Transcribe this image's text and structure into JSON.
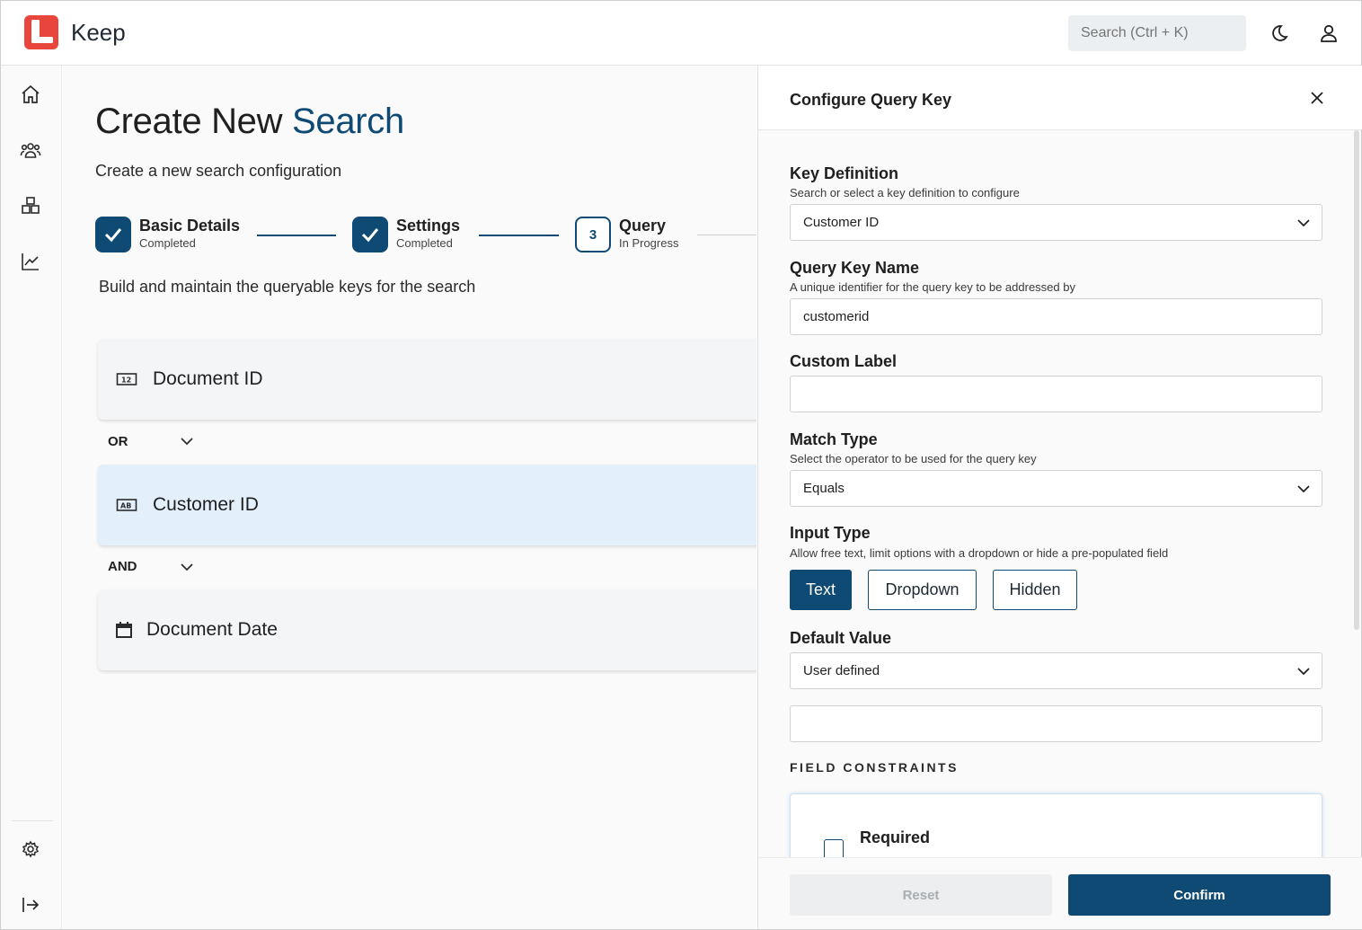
{
  "app": {
    "name": "Keep"
  },
  "header": {
    "search_placeholder": "Search (Ctrl + K)"
  },
  "sidebar": {
    "items": [
      {
        "icon": "home-icon"
      },
      {
        "icon": "users-icon"
      },
      {
        "icon": "boxes-icon"
      },
      {
        "icon": "chart-line-icon"
      }
    ],
    "bottom": [
      {
        "icon": "gear-icon"
      },
      {
        "icon": "expand-icon"
      }
    ]
  },
  "main": {
    "title_part1": "Create New ",
    "title_part2": "Search",
    "subtitle": "Create a new search configuration",
    "steps": [
      {
        "title": "Basic Details",
        "status": "Completed"
      },
      {
        "title": "Settings",
        "status": "Completed"
      },
      {
        "number": "3",
        "title": "Query",
        "status": "In Progress"
      }
    ],
    "build_text": "Build and maintain the queryable keys for the search",
    "keys": [
      {
        "label": "Document ID",
        "icon": "number-field-icon"
      },
      {
        "label": "Customer ID",
        "icon": "text-field-icon",
        "selected": true
      },
      {
        "label": "Document Date",
        "icon": "calendar-icon"
      }
    ],
    "operators": [
      "OR",
      "AND"
    ]
  },
  "panel": {
    "title": "Configure Query Key",
    "key_definition": {
      "label": "Key Definition",
      "help": "Search or select a key definition to configure",
      "value": "Customer ID"
    },
    "query_key_name": {
      "label": "Query Key Name",
      "help": "A unique identifier for the query key to be addressed by",
      "value": "customerid"
    },
    "custom_label": {
      "label": "Custom Label",
      "value": ""
    },
    "match_type": {
      "label": "Match Type",
      "help": "Select the operator to be used for the query key",
      "value": "Equals"
    },
    "input_type": {
      "label": "Input Type",
      "help": "Allow free text, limit options with a dropdown or hide a pre-populated field",
      "options": [
        "Text",
        "Dropdown",
        "Hidden"
      ],
      "selected": "Text"
    },
    "default_value": {
      "label": "Default Value",
      "value": "User defined",
      "extra_value": ""
    },
    "field_constraints": {
      "title": "FIELD CONSTRAINTS",
      "required_label": "Required"
    },
    "footer": {
      "reset_label": "Reset",
      "confirm_label": "Confirm"
    }
  },
  "colors": {
    "accent": "#0e4a73",
    "brand": "#e8453c",
    "selected_card": "#e3effb"
  }
}
